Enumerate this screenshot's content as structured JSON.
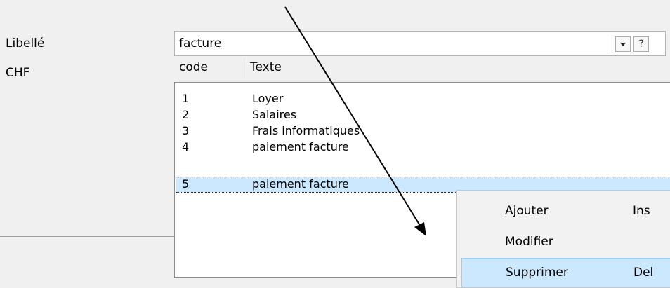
{
  "form": {
    "libelle_label": "Libellé",
    "chf_label": "CHF",
    "libelle_value": "facture",
    "help_label": "?"
  },
  "list": {
    "columns": [
      "code",
      "Texte"
    ],
    "rows": [
      {
        "code": "1",
        "text": "Loyer"
      },
      {
        "code": "2",
        "text": "Salaires"
      },
      {
        "code": "3",
        "text": "Frais informatiques"
      },
      {
        "code": "4",
        "text": "paiement facture"
      },
      {
        "code": "5",
        "text": "paiement facture"
      }
    ],
    "selected_code": "5"
  },
  "context_menu": {
    "items": [
      {
        "label": "Ajouter",
        "shortcut": "Ins"
      },
      {
        "label": "Modifier",
        "shortcut": ""
      },
      {
        "label": "Supprimer",
        "shortcut": "Del"
      }
    ],
    "highlighted": "Supprimer"
  },
  "colors": {
    "selection": "#cce8ff",
    "menu_highlight_border": "#99ccff"
  }
}
